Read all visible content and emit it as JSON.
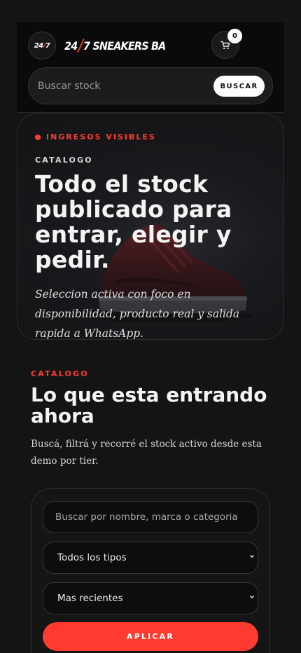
{
  "header": {
    "logo_badge_left": "24",
    "logo_badge_slash": "/",
    "logo_badge_right": "7",
    "brand_left": "24",
    "brand_slash": "/",
    "brand_right": "7 SNEAKERS BA",
    "cart_count": "0",
    "cart_icon": "cart-icon"
  },
  "search": {
    "placeholder": "Buscar stock",
    "button_label": "BUSCAR"
  },
  "hero": {
    "live_label": "INGRESOS VISIBLES",
    "kicker": "CATALOGO",
    "title": "Todo el stock publicado para entrar, elegir y pedir.",
    "text": "Seleccion activa con foco en disponibilidad, producto real y salida rapida a WhatsApp.",
    "image_icon": "sneaker-image"
  },
  "catalog": {
    "kicker": "CATALOGO",
    "title": "Lo que esta entrando ahora",
    "text": "Buscá, filtrá y recorré el stock activo desde esta demo por tier."
  },
  "filters": {
    "search_placeholder": "Buscar por nombre, marca o categoria",
    "type_select": "Todos los tipos",
    "sort_select": "Mas recientes",
    "apply_label": "APLICAR"
  },
  "colors": {
    "accent": "#ff3b30",
    "background": "#141414",
    "panel": "#0a0a0a"
  }
}
